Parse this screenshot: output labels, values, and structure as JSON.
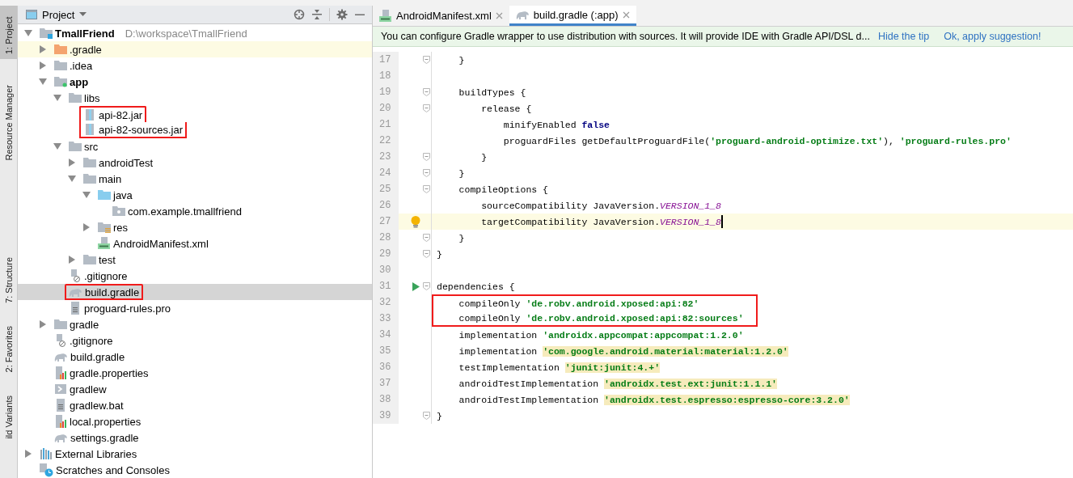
{
  "tool_strip": [
    {
      "label": "1: Project",
      "selected": true
    },
    {
      "label": "Resource Manager",
      "selected": false
    },
    {
      "label": "7: Structure",
      "selected": false
    },
    {
      "label": "2: Favorites",
      "selected": false
    },
    {
      "label": "ild Variants",
      "selected": false
    }
  ],
  "project_panel": {
    "title": "Project",
    "tree": [
      {
        "name": "TmallFriend",
        "path": "D:\\workspace\\TmallFriend",
        "kind": "project",
        "expanded": true,
        "children": [
          {
            "name": ".gradle",
            "kind": "folder_excluded",
            "expanded": false,
            "highlighted": true
          },
          {
            "name": ".idea",
            "kind": "folder",
            "expanded": false
          },
          {
            "name": "app",
            "kind": "module",
            "expanded": true,
            "children": [
              {
                "name": "libs",
                "kind": "folder",
                "expanded": true,
                "children": [
                  {
                    "name": "api-82.jar",
                    "kind": "jar",
                    "outlined": true
                  },
                  {
                    "name": "api-82-sources.jar",
                    "kind": "jar",
                    "outlined": true
                  }
                ]
              },
              {
                "name": "src",
                "kind": "folder",
                "expanded": true,
                "children": [
                  {
                    "name": "androidTest",
                    "kind": "folder",
                    "expanded": false
                  },
                  {
                    "name": "main",
                    "kind": "folder",
                    "expanded": true,
                    "children": [
                      {
                        "name": "java",
                        "kind": "source_folder",
                        "expanded": true,
                        "children": [
                          {
                            "name": "com.example.tmallfriend",
                            "kind": "package"
                          }
                        ]
                      },
                      {
                        "name": "res",
                        "kind": "res_folder",
                        "expanded": false
                      },
                      {
                        "name": "AndroidManifest.xml",
                        "kind": "manifest"
                      }
                    ]
                  },
                  {
                    "name": "test",
                    "kind": "folder",
                    "expanded": false
                  }
                ]
              },
              {
                "name": ".gitignore",
                "kind": "ignore"
              },
              {
                "name": "build.gradle",
                "kind": "gradle",
                "selected": true,
                "outlined": true
              },
              {
                "name": "proguard-rules.pro",
                "kind": "text"
              }
            ]
          },
          {
            "name": "gradle",
            "kind": "folder",
            "expanded": false
          },
          {
            "name": ".gitignore",
            "kind": "ignore"
          },
          {
            "name": "build.gradle",
            "kind": "gradle"
          },
          {
            "name": "gradle.properties",
            "kind": "properties"
          },
          {
            "name": "gradlew",
            "kind": "script"
          },
          {
            "name": "gradlew.bat",
            "kind": "text"
          },
          {
            "name": "local.properties",
            "kind": "properties"
          },
          {
            "name": "settings.gradle",
            "kind": "gradle"
          }
        ]
      },
      {
        "name": "External Libraries",
        "kind": "libraries",
        "expanded": false
      },
      {
        "name": "Scratches and Consoles",
        "kind": "scratches"
      }
    ]
  },
  "editor": {
    "tabs": [
      {
        "label": "AndroidManifest.xml",
        "kind": "manifest",
        "selected": false
      },
      {
        "label": "build.gradle (:app)",
        "kind": "gradle",
        "selected": true
      }
    ],
    "banner": {
      "text": "You can configure Gradle wrapper to use distribution with sources. It will provide IDE with Gradle API/DSL d...",
      "links": [
        "Hide the tip",
        "Ok, apply suggestion!"
      ]
    },
    "lines": [
      {
        "number": "17",
        "fold": true,
        "segments": [
          {
            "text": "    }",
            "kind": "plain"
          }
        ]
      },
      {
        "number": "18"
      },
      {
        "number": "19",
        "fold": true,
        "segments": [
          {
            "text": "    buildTypes {",
            "kind": "plain"
          }
        ]
      },
      {
        "number": "20",
        "fold": true,
        "segments": [
          {
            "text": "        release {",
            "kind": "plain"
          }
        ]
      },
      {
        "number": "21",
        "segments": [
          {
            "text": "            minifyEnabled ",
            "kind": "plain"
          },
          {
            "text": "false",
            "kind": "keyword"
          }
        ]
      },
      {
        "number": "22",
        "segments": [
          {
            "text": "            proguardFiles getDefaultProguardFile(",
            "kind": "plain"
          },
          {
            "text": "'proguard-android-optimize.txt'",
            "kind": "string"
          },
          {
            "text": "), ",
            "kind": "plain"
          },
          {
            "text": "'proguard-rules.pro'",
            "kind": "string"
          }
        ]
      },
      {
        "number": "23",
        "fold": true,
        "segments": [
          {
            "text": "        }",
            "kind": "plain"
          }
        ]
      },
      {
        "number": "24",
        "fold": true,
        "segments": [
          {
            "text": "    }",
            "kind": "plain"
          }
        ]
      },
      {
        "number": "25",
        "fold": true,
        "segments": [
          {
            "text": "    compileOptions {",
            "kind": "plain"
          }
        ]
      },
      {
        "number": "26",
        "segments": [
          {
            "text": "        sourceCompatibility JavaVersion.",
            "kind": "plain"
          },
          {
            "text": "VERSION_1_8",
            "kind": "constant"
          }
        ]
      },
      {
        "number": "27",
        "current": true,
        "intention_bulb": true,
        "segments": [
          {
            "text": "        targetCompatibility JavaVersion.",
            "kind": "plain"
          },
          {
            "text": "VERSION_1_8",
            "kind": "constant"
          }
        ]
      },
      {
        "number": "28",
        "fold": true,
        "segments": [
          {
            "text": "    }",
            "kind": "plain"
          }
        ]
      },
      {
        "number": "29",
        "fold": true,
        "segments": [
          {
            "text": "}",
            "kind": "plain"
          }
        ]
      },
      {
        "number": "30"
      },
      {
        "number": "31",
        "fold": true,
        "runnable": true,
        "segments": [
          {
            "text": "dependencies {",
            "kind": "plain"
          }
        ]
      },
      {
        "number": "32",
        "outlined": true,
        "segments": [
          {
            "text": "    compileOnly ",
            "kind": "plain"
          },
          {
            "text": "'de.robv.android.xposed:api:82'",
            "kind": "string"
          }
        ]
      },
      {
        "number": "33",
        "outlined": true,
        "segments": [
          {
            "text": "    compileOnly ",
            "kind": "plain"
          },
          {
            "text": "'de.robv.android.xposed:api:82:sources'",
            "kind": "string"
          }
        ]
      },
      {
        "number": "34",
        "segments": [
          {
            "text": "    implementation ",
            "kind": "plain"
          },
          {
            "text": "'androidx.appcompat:appcompat:1.2.0'",
            "kind": "string"
          }
        ]
      },
      {
        "number": "35",
        "segments": [
          {
            "text": "    implementation ",
            "kind": "plain"
          },
          {
            "text": "'com.google.android.material:material:1.2.0'",
            "kind": "string_warn"
          }
        ]
      },
      {
        "number": "36",
        "segments": [
          {
            "text": "    testImplementation ",
            "kind": "plain"
          },
          {
            "text": "'junit:junit:4.+'",
            "kind": "string_warn"
          }
        ]
      },
      {
        "number": "37",
        "segments": [
          {
            "text": "    androidTestImplementation ",
            "kind": "plain"
          },
          {
            "text": "'androidx.test.ext:junit:1.1.1'",
            "kind": "string_warn"
          }
        ]
      },
      {
        "number": "38",
        "segments": [
          {
            "text": "    androidTestImplementation ",
            "kind": "plain"
          },
          {
            "text": "'androidx.test.espresso:espresso-core:3.2.0'",
            "kind": "string_warn"
          }
        ]
      },
      {
        "number": "39",
        "fold": true,
        "segments": [
          {
            "text": "}",
            "kind": "plain"
          }
        ]
      }
    ]
  }
}
